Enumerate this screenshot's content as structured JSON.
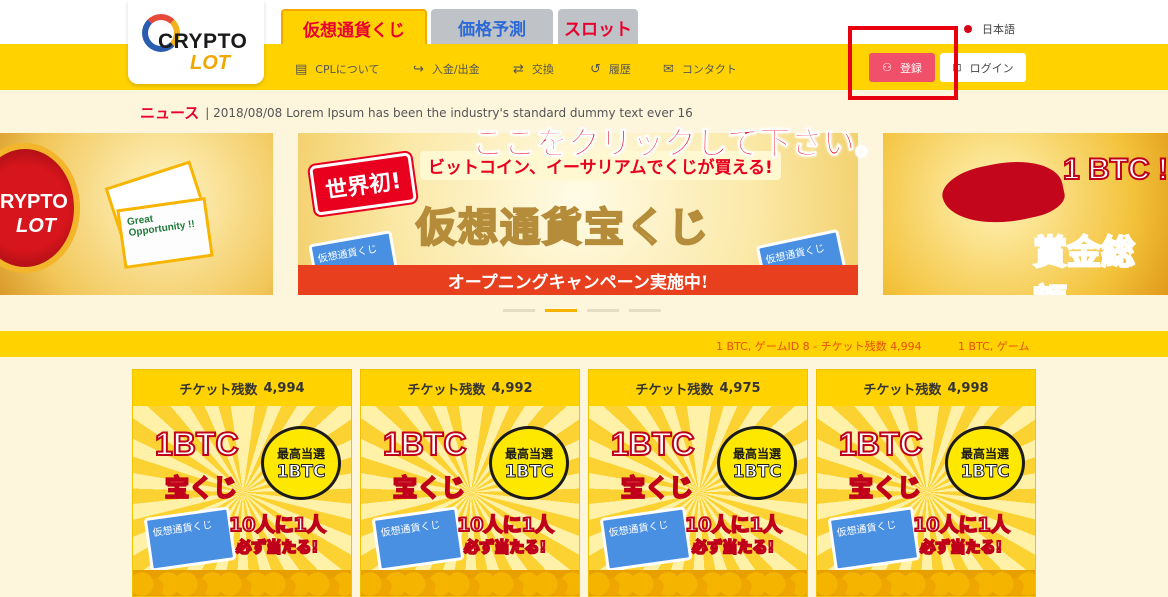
{
  "header": {
    "logo": {
      "line1": "CRYPTO",
      "line2": "LOT"
    },
    "tabs": [
      {
        "label": "仮想通貨くじ"
      },
      {
        "label": "価格予測"
      },
      {
        "label": "スロット"
      }
    ],
    "language": "日本語"
  },
  "nav": {
    "items": [
      {
        "label": "CPLについて",
        "icon": "book-icon",
        "glyph": "▤"
      },
      {
        "label": "入金/出金",
        "icon": "share-arrow-icon",
        "glyph": "↪"
      },
      {
        "label": "交換",
        "icon": "exchange-icon",
        "glyph": "⇄"
      },
      {
        "label": "履歴",
        "icon": "history-icon",
        "glyph": "↺"
      },
      {
        "label": "コンタクト",
        "icon": "mail-icon",
        "glyph": "✉"
      }
    ],
    "register_label": "登録",
    "login_label": "ログイン"
  },
  "news": {
    "label": "ニュース",
    "text": "| 2018/08/08 Lorem Ipsum has been the industry's standard dummy text ever 16"
  },
  "annotation": "ここをクリックして下さい。",
  "banners": {
    "left": {
      "coin_text": "RYPTO",
      "coin_sub": "LOT",
      "ticket_text": "Great Opportunity !!"
    },
    "main": {
      "seal": "世界初!",
      "subtitle": "ビットコイン、イーサリアムでくじが買える!",
      "title": "仮想通貨宝くじ",
      "ticket_text": "仮想通貨くじ",
      "strip": "オープニングキャンペーン実施中!"
    },
    "right": {
      "line1": "1 BTC !",
      "line2": "賞金総額"
    }
  },
  "ticker": [
    "1 BTC, ゲームID 8 - チケット残数 4,994",
    "1 BTC, ゲーム"
  ],
  "cards": [
    {
      "ticket_label": "チケット残数",
      "remaining": "4,994"
    },
    {
      "ticket_label": "チケット残数",
      "remaining": "4,992"
    },
    {
      "ticket_label": "チケット残数",
      "remaining": "4,975"
    },
    {
      "ticket_label": "チケット残数",
      "remaining": "4,998"
    }
  ],
  "card_art": {
    "btc": "1BTC",
    "kuji": "宝くじ",
    "burst_top": "最高当選",
    "burst_big": "1BTC",
    "ticket": "仮想通貨くじ",
    "odds_line1": "10人に1人",
    "odds_line2": "必ず当たる!"
  },
  "colors": {
    "accent_yellow": "#ffd200",
    "register_pink": "#f0506a",
    "highlight_red": "#e8000f"
  }
}
